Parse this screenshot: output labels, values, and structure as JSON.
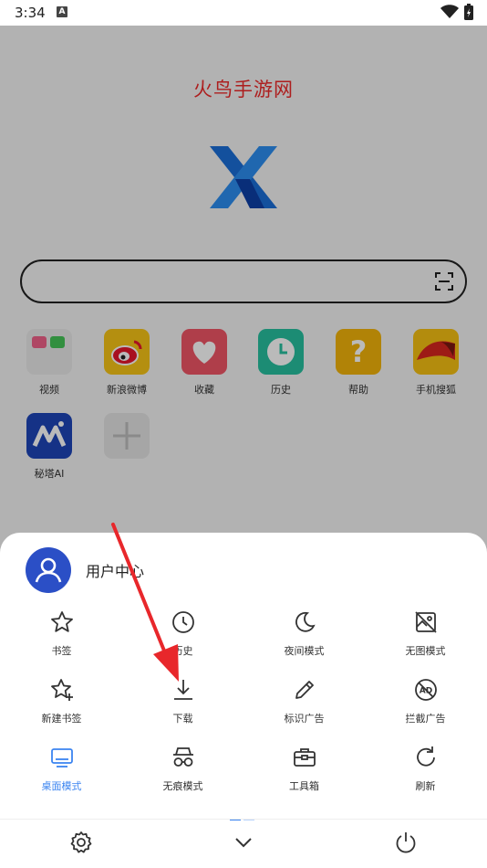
{
  "status_bar": {
    "time": "3:34",
    "notification_icon": "A"
  },
  "browser": {
    "brand_text": "火鸟手游网",
    "logo_icon": "x-browser-logo"
  },
  "search": {
    "placeholder": "",
    "scan_icon": "scan-icon"
  },
  "shortcuts": [
    {
      "label": "视频",
      "icon": "video-folder-icon"
    },
    {
      "label": "新浪微博",
      "icon": "weibo-icon"
    },
    {
      "label": "收藏",
      "icon": "heart-icon"
    },
    {
      "label": "历史",
      "icon": "clock-icon"
    },
    {
      "label": "帮助",
      "icon": "question-icon"
    },
    {
      "label": "手机搜狐",
      "icon": "sohu-fox-icon"
    },
    {
      "label": "秘塔AI",
      "icon": "metaso-icon"
    },
    {
      "label": "",
      "icon": "plus-icon"
    }
  ],
  "sheet": {
    "user_center": "用户中心",
    "menu": [
      {
        "label": "书签",
        "icon": "star-icon"
      },
      {
        "label": "历史",
        "icon": "clock-icon"
      },
      {
        "label": "夜间模式",
        "icon": "moon-icon"
      },
      {
        "label": "无图模式",
        "icon": "no-image-icon"
      },
      {
        "label": "新建书签",
        "icon": "star-plus-icon"
      },
      {
        "label": "下载",
        "icon": "download-icon"
      },
      {
        "label": "标识广告",
        "icon": "pencil-icon"
      },
      {
        "label": "拦截广告",
        "icon": "ad-block-icon"
      },
      {
        "label": "桌面模式",
        "icon": "desktop-icon",
        "active": true
      },
      {
        "label": "无痕模式",
        "icon": "incognito-icon"
      },
      {
        "label": "工具箱",
        "icon": "toolbox-icon"
      },
      {
        "label": "刷新",
        "icon": "refresh-icon"
      }
    ],
    "bottom_bar": [
      "gear-icon",
      "chevron-down-icon",
      "power-icon"
    ]
  },
  "colors": {
    "accent": "#3b84f0",
    "brand_text": "#ee2a2a",
    "avatar": "#2b4fc6",
    "arrow": "#e8272b"
  }
}
